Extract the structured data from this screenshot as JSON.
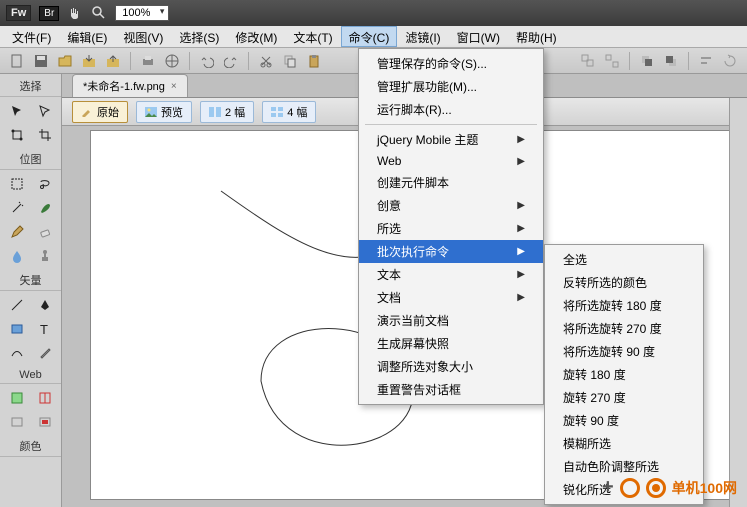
{
  "app": {
    "logo": "Fw",
    "badge": "Br",
    "zoom": "100%"
  },
  "menubar": [
    "文件(F)",
    "编辑(E)",
    "视图(V)",
    "选择(S)",
    "修改(M)",
    "文本(T)",
    "命令(C)",
    "滤镜(I)",
    "窗口(W)",
    "帮助(H)"
  ],
  "menubar_active_index": 6,
  "file_tab": {
    "label": "*未命名-1.fw.png"
  },
  "viewbar": {
    "original": "原始",
    "preview": "预览",
    "two_up": "2 幅",
    "four_up": "4 幅"
  },
  "sidebar": {
    "select": "选择",
    "bitmap": "位图",
    "vector": "矢量",
    "web": "Web",
    "colors": "颜色"
  },
  "menu_commands": {
    "manage_saved": "管理保存的命令(S)...",
    "manage_ext": "管理扩展功能(M)...",
    "run_script": "运行脚本(R)...",
    "jquery": "jQuery Mobile 主题",
    "web": "Web",
    "create_script": "创建元件脚本",
    "creative": "创意",
    "selection": "所选",
    "batch": "批次执行命令",
    "text": "文本",
    "document": "文档",
    "demo_doc": "演示当前文档",
    "screenshot": "生成屏幕快照",
    "resize_sel": "调整所选对象大小",
    "reset_warn": "重置警告对话框"
  },
  "submenu_batch": [
    "全选",
    "反转所选的颜色",
    "将所选旋转 180 度",
    "将所选旋转 270 度",
    "将所选旋转 90 度",
    "旋转 180 度",
    "旋转 270 度",
    "旋转 90 度",
    "模糊所选",
    "自动色阶调整所选",
    "锐化所选"
  ],
  "watermark": "单机100网"
}
